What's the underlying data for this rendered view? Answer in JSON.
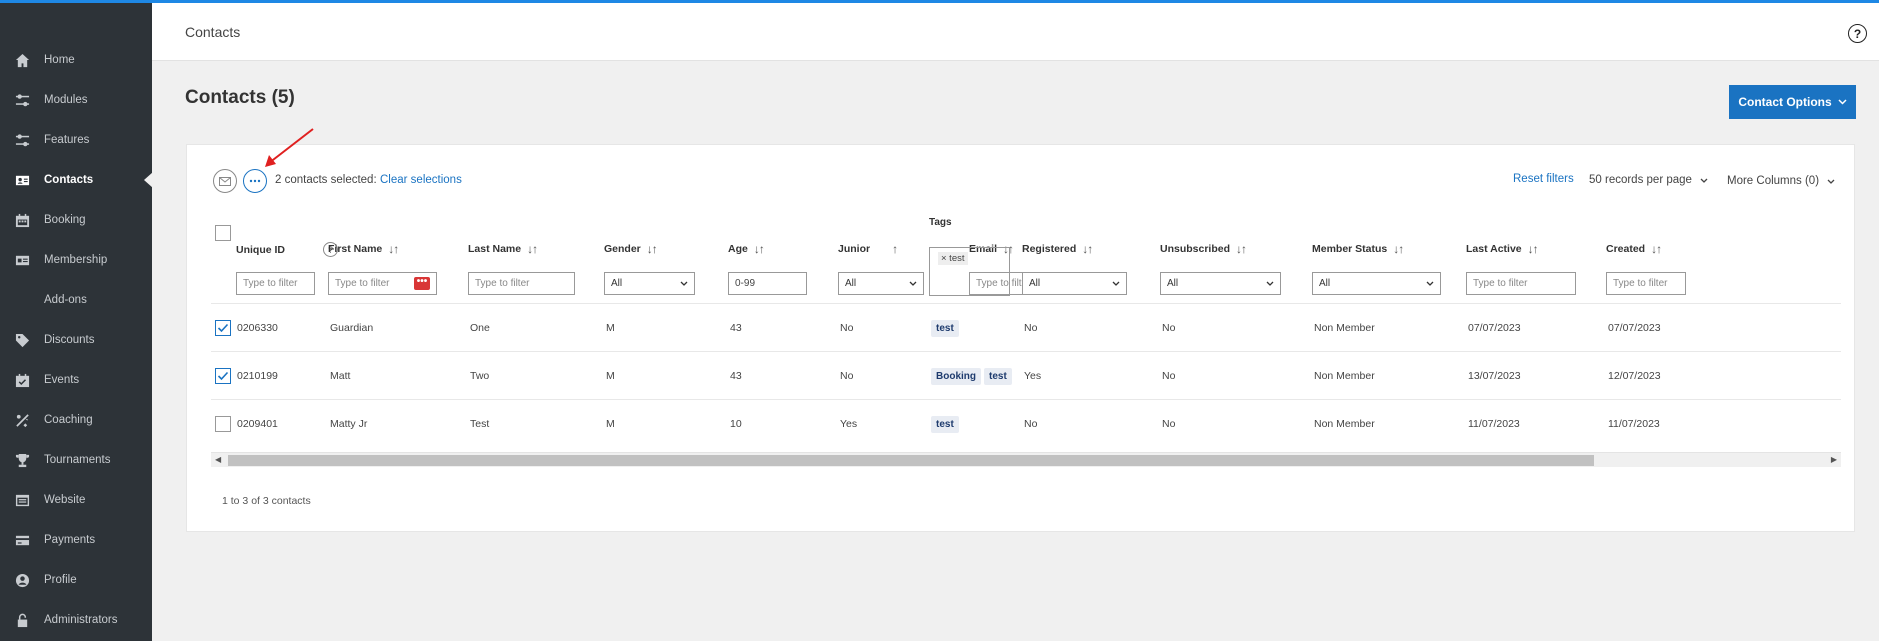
{
  "colors": {
    "accent": "#1a73c2",
    "sidebar_bg": "#2d3338",
    "danger": "#d93636",
    "annotation_arrow": "#e02020"
  },
  "sidebar": {
    "items": [
      {
        "label": "Home",
        "icon": "home-icon",
        "active": false
      },
      {
        "label": "Modules",
        "icon": "sliders-icon",
        "active": false
      },
      {
        "label": "Features",
        "icon": "sliders-icon",
        "active": false
      },
      {
        "label": "Contacts",
        "icon": "contact-card-icon",
        "active": true
      },
      {
        "label": "Booking",
        "icon": "calendar-icon",
        "active": false
      },
      {
        "label": "Membership",
        "icon": "id-card-icon",
        "active": false
      },
      {
        "label": "Add-ons",
        "icon": "",
        "active": false
      },
      {
        "label": "Discounts",
        "icon": "tag-icon",
        "active": false
      },
      {
        "label": "Events",
        "icon": "calendar-check-icon",
        "active": false
      },
      {
        "label": "Coaching",
        "icon": "coaching-icon",
        "active": false
      },
      {
        "label": "Tournaments",
        "icon": "trophy-icon",
        "active": false
      },
      {
        "label": "Website",
        "icon": "website-icon",
        "active": false
      },
      {
        "label": "Payments",
        "icon": "credit-card-icon",
        "active": false
      },
      {
        "label": "Profile",
        "icon": "user-circle-icon",
        "active": false
      },
      {
        "label": "Administrators",
        "icon": "lock-icon",
        "active": false
      }
    ]
  },
  "header": {
    "breadcrumb": "Contacts",
    "help": "?"
  },
  "page": {
    "title": "Contacts (5)",
    "options_button": "Contact Options"
  },
  "toolbar": {
    "selected_text": "2 contacts selected:",
    "clear_label": "Clear selections",
    "reset_label": "Reset filters",
    "records_label": "50 records per page",
    "more_columns_label": "More Columns (0)"
  },
  "table": {
    "columns": {
      "unique_id": "Unique ID",
      "first_name": "First Name",
      "last_name": "Last Name",
      "gender": "Gender",
      "age": "Age",
      "junior": "Junior",
      "email": "Email",
      "tags": "Tags",
      "registered": "Registered",
      "unsubscribed": "Unsubscribed",
      "member_status": "Member Status",
      "last_active": "Last Active",
      "created": "Created"
    },
    "filters": {
      "placeholder": "Type to filter",
      "gender": "All",
      "age": "0-99",
      "junior": "All",
      "tag_chip": "× test",
      "registered": "All",
      "unsubscribed": "All",
      "member_status": "All"
    },
    "rows": [
      {
        "checked": true,
        "id": "0206330",
        "first": "Guardian",
        "last": "One",
        "gender": "M",
        "age": "43",
        "junior": "No",
        "email": "",
        "tags": [
          "test"
        ],
        "registered": "No",
        "unsubscribed": "No",
        "member_status": "Non Member",
        "last_active": "07/07/2023",
        "created": "07/07/2023"
      },
      {
        "checked": true,
        "id": "0210199",
        "first": "Matt",
        "last": "Two",
        "gender": "M",
        "age": "43",
        "junior": "No",
        "email": "",
        "tags": [
          "Booking",
          "test"
        ],
        "registered": "Yes",
        "unsubscribed": "No",
        "member_status": "Non Member",
        "last_active": "13/07/2023",
        "created": "12/07/2023"
      },
      {
        "checked": false,
        "id": "0209401",
        "first": "Matty Jr",
        "last": "Test",
        "gender": "M",
        "age": "10",
        "junior": "Yes",
        "email": "",
        "tags": [
          "test"
        ],
        "registered": "No",
        "unsubscribed": "No",
        "member_status": "Non Member",
        "last_active": "11/07/2023",
        "created": "11/07/2023"
      }
    ]
  },
  "footer": {
    "count": "1 to 3 of 3 contacts"
  }
}
